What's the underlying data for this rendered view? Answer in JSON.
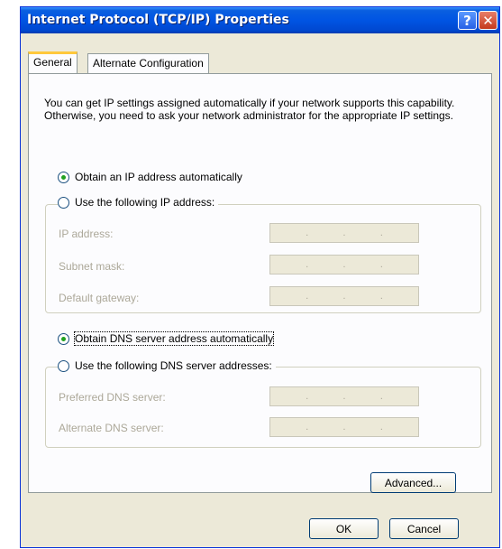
{
  "window": {
    "title": "Internet Protocol (TCP/IP) Properties",
    "help_button": "?",
    "close_button": "✕"
  },
  "tabs": [
    {
      "label": "General"
    },
    {
      "label": "Alternate Configuration"
    }
  ],
  "intro_text": "You can get IP settings assigned automatically if your network supports this capability. Otherwise, you need to ask your network administrator for the appropriate IP settings.",
  "ip": {
    "obtain_auto_label": "Obtain an IP address automatically",
    "use_following_label": "Use the following IP address:",
    "selected": "obtain_auto",
    "fields": [
      {
        "label": "IP address:",
        "value": " .   .   . "
      },
      {
        "label": "Subnet mask:",
        "value": " .   .   . "
      },
      {
        "label": "Default gateway:",
        "value": " .   .   . "
      }
    ]
  },
  "dns": {
    "obtain_auto_label": "Obtain DNS server address automatically",
    "use_following_label": "Use the following DNS server addresses:",
    "selected": "obtain_auto",
    "fields": [
      {
        "label": "Preferred DNS server:",
        "value": " .   .   . "
      },
      {
        "label": "Alternate DNS server:",
        "value": " .   .   . "
      }
    ]
  },
  "buttons": {
    "advanced": "Advanced...",
    "ok": "OK",
    "cancel": "Cancel"
  }
}
